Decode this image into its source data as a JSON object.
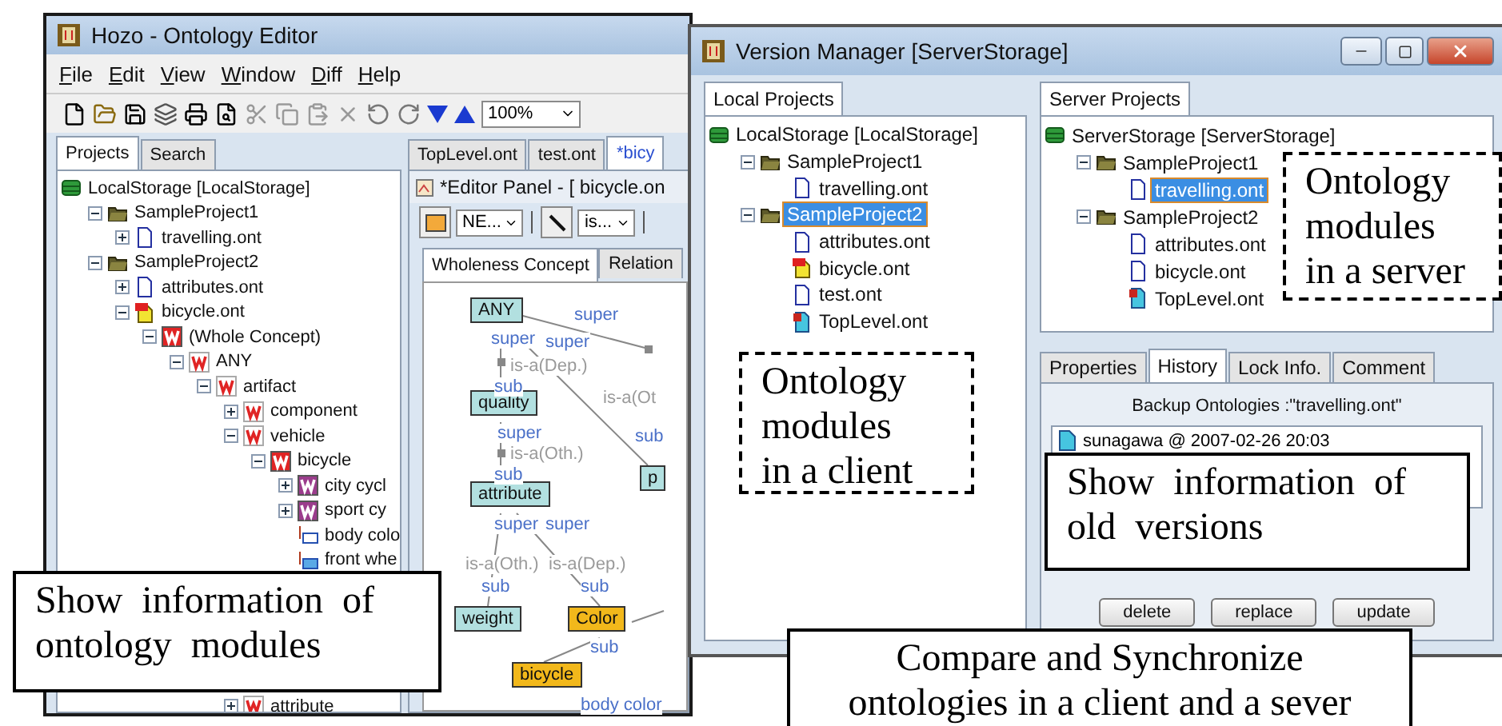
{
  "hozo": {
    "title": "Hozo - Ontology Editor",
    "menu": [
      "File",
      "Edit",
      "View",
      "Window",
      "Diff",
      "Help"
    ],
    "zoom": "100%",
    "side_tabs": [
      {
        "label": "Projects",
        "selected": true
      },
      {
        "label": "Search",
        "selected": false
      }
    ],
    "tree": [
      {
        "label": "LocalStorage [LocalStorage]",
        "kind": "storage",
        "selected": false,
        "children": [
          {
            "label": "SampleProject1",
            "kind": "folder",
            "expanded": true,
            "selected": false,
            "children": [
              {
                "label": "travelling.ont",
                "kind": "file",
                "expanded": false,
                "selected": false
              }
            ]
          },
          {
            "label": "SampleProject2",
            "kind": "folder",
            "expanded": true,
            "selected": false,
            "children": [
              {
                "label": "attributes.ont",
                "kind": "file",
                "expanded": false,
                "selected": false
              },
              {
                "label": "bicycle.ont",
                "kind": "file-up",
                "expanded": true,
                "selected": false,
                "children": [
                  {
                    "label": "(Whole Concept)",
                    "kind": "w-red",
                    "expanded": true,
                    "selected": false,
                    "children": [
                      {
                        "label": "ANY",
                        "kind": "w-outline",
                        "expanded": true,
                        "selected": false,
                        "children": [
                          {
                            "label": "artifact",
                            "kind": "w-outline",
                            "expanded": true,
                            "selected": false,
                            "children": [
                              {
                                "label": "component",
                                "kind": "w-outline",
                                "expanded": false,
                                "selected": false
                              },
                              {
                                "label": "vehicle",
                                "kind": "w-outline",
                                "expanded": true,
                                "selected": false,
                                "children": [
                                  {
                                    "label": "bicycle",
                                    "kind": "w-red",
                                    "expanded": true,
                                    "selected": false,
                                    "children": [
                                      {
                                        "label": "city cycl",
                                        "kind": "w-purple",
                                        "expanded": false,
                                        "selected": false
                                      },
                                      {
                                        "label": "sport cy",
                                        "kind": "w-purple",
                                        "expanded": false,
                                        "selected": false
                                      },
                                      {
                                        "label": "body colo",
                                        "kind": "part",
                                        "selected": false
                                      },
                                      {
                                        "label": "front whe",
                                        "kind": "part-filled",
                                        "selected": false
                                      }
                                    ]
                                  }
                                ]
                              },
                              {
                                "label": "attribute",
                                "kind": "w-outline",
                                "expanded": false,
                                "selected": false
                              }
                            ]
                          }
                        ]
                      }
                    ]
                  }
                ]
              }
            ]
          }
        ]
      }
    ],
    "file_tabs": [
      {
        "label": "TopLevel.ont",
        "selected": false
      },
      {
        "label": "test.ont",
        "selected": false
      },
      {
        "label": "*bicy",
        "selected": true
      }
    ],
    "editor": {
      "title": "*Editor Panel - [ bicycle.on",
      "node_type": "NE...",
      "link_type": "is...",
      "tabs": [
        {
          "label": "Wholeness Concept",
          "selected": true
        },
        {
          "label": "Relation",
          "selected": false
        }
      ],
      "nodes": [
        {
          "label": "ANY",
          "kind": "basic"
        },
        {
          "label": "quality",
          "kind": "basic"
        },
        {
          "label": "attribute",
          "kind": "basic"
        },
        {
          "label": "weight",
          "kind": "basic"
        },
        {
          "label": "Color",
          "kind": "whole"
        },
        {
          "label": "bicycle",
          "kind": "whole"
        },
        {
          "label": "p",
          "kind": "basic"
        }
      ],
      "labels": [
        {
          "text": "super",
          "kind": "role"
        },
        {
          "text": "super",
          "kind": "role"
        },
        {
          "text": "super",
          "kind": "role"
        },
        {
          "text": "is-a(Dep.)",
          "kind": "link"
        },
        {
          "text": "sub",
          "kind": "role"
        },
        {
          "text": "is-a(Ot",
          "kind": "link"
        },
        {
          "text": "super",
          "kind": "role"
        },
        {
          "text": "sub",
          "kind": "role"
        },
        {
          "text": "is-a(Oth.)",
          "kind": "link"
        },
        {
          "text": "sub",
          "kind": "role"
        },
        {
          "text": "super",
          "kind": "role"
        },
        {
          "text": "super",
          "kind": "role"
        },
        {
          "text": "is-a(Oth.)",
          "kind": "link"
        },
        {
          "text": "is-a(Dep.)",
          "kind": "link"
        },
        {
          "text": "sub",
          "kind": "role"
        },
        {
          "text": "sub",
          "kind": "role"
        },
        {
          "text": "sub",
          "kind": "role"
        },
        {
          "text": "body color",
          "kind": "role"
        }
      ]
    }
  },
  "version_manager": {
    "title": "Version Manager [ServerStorage]",
    "local_tab": "Local Projects",
    "local_tree": [
      {
        "label": "LocalStorage [LocalStorage]",
        "kind": "storage",
        "selected": false,
        "children": [
          {
            "label": "SampleProject1",
            "kind": "folder",
            "expanded": true,
            "selected": false,
            "children": [
              {
                "label": "travelling.ont",
                "kind": "file",
                "selected": false
              }
            ]
          },
          {
            "label": "SampleProject2",
            "kind": "folder",
            "expanded": true,
            "selected": true,
            "children": [
              {
                "label": "attributes.ont",
                "kind": "file",
                "selected": false
              },
              {
                "label": "bicycle.ont",
                "kind": "file-up",
                "selected": false
              },
              {
                "label": "test.ont",
                "kind": "file",
                "selected": false
              },
              {
                "label": "TopLevel.ont",
                "kind": "file-top",
                "selected": false
              }
            ]
          }
        ]
      }
    ],
    "server_tab": "Server Projects",
    "server_tree": [
      {
        "label": "ServerStorage [ServerStorage]",
        "kind": "storage",
        "selected": false,
        "children": [
          {
            "label": "SampleProject1",
            "kind": "folder",
            "expanded": true,
            "selected": false,
            "children": [
              {
                "label": "travelling.ont",
                "kind": "file",
                "selected": true
              }
            ]
          },
          {
            "label": "SampleProject2",
            "kind": "folder",
            "expanded": true,
            "selected": false,
            "children": [
              {
                "label": "attributes.ont",
                "kind": "file",
                "selected": false
              },
              {
                "label": "bicycle.ont",
                "kind": "file",
                "selected": false
              },
              {
                "label": "TopLevel.ont",
                "kind": "file-top",
                "selected": false
              }
            ]
          }
        ]
      }
    ],
    "info_tabs": [
      {
        "label": "Properties",
        "selected": false
      },
      {
        "label": "History",
        "selected": true
      },
      {
        "label": "Lock Info.",
        "selected": false
      },
      {
        "label": "Comment",
        "selected": false
      }
    ],
    "backup_label": "Backup Ontologies :\"travelling.ont\"",
    "backups": [
      "sunagawa @ 2007-02-26 20:03"
    ],
    "buttons": [
      "delete",
      "replace",
      "update"
    ]
  },
  "callouts": [
    {
      "kind": "solid",
      "lines": [
        "Show information of",
        "ontology modules"
      ]
    },
    {
      "kind": "dashed",
      "lines": [
        "Ontology",
        "modules",
        "in a client"
      ]
    },
    {
      "kind": "dashed",
      "lines": [
        "Ontology",
        "modules",
        "in a server"
      ]
    },
    {
      "kind": "solid",
      "lines": [
        "Show information of",
        "old versions"
      ]
    },
    {
      "kind": "solid",
      "lines": [
        "Compare and Synchronize",
        "ontologies in a client and a sever"
      ]
    }
  ]
}
